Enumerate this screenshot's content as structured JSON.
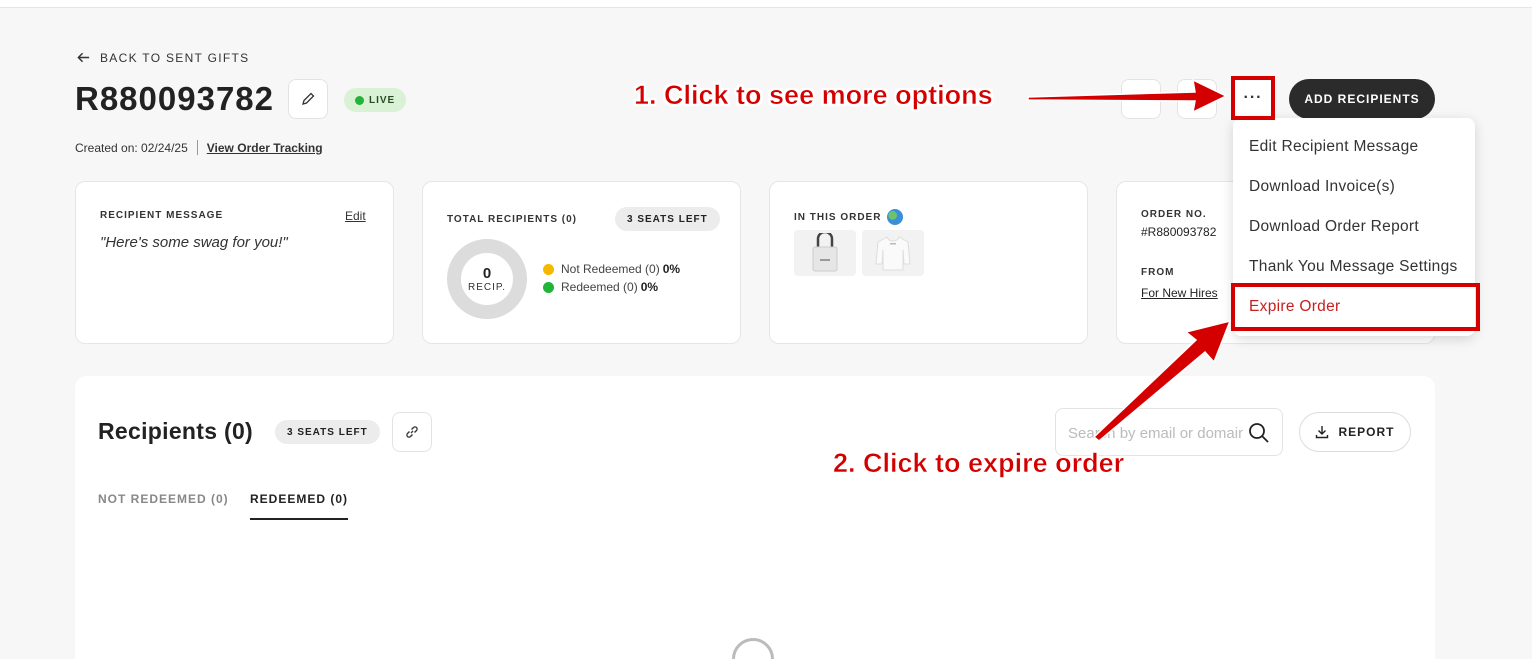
{
  "header": {
    "back_label": "BACK TO SENT GIFTS",
    "order_id": "R880093782",
    "status_badge": "LIVE",
    "created_label": "Created on: 02/24/25",
    "tracking_link": "View Order Tracking",
    "add_recipients_label": "ADD RECIPIENTS",
    "more_label": "···"
  },
  "cards": {
    "message": {
      "label": "RECIPIENT MESSAGE",
      "edit_label": "Edit",
      "text": "\"Here's some swag for you!\""
    },
    "totals": {
      "label": "TOTAL RECIPIENTS (0)",
      "seats_left": "3 SEATS LEFT",
      "donut_value": "0",
      "donut_caption": "RECIP.",
      "legend": [
        {
          "label": "Not Redeemed (0)",
          "pct": "0%",
          "color": "#f5b800"
        },
        {
          "label": "Redeemed (0)",
          "pct": "0%",
          "color": "#22b33a"
        }
      ]
    },
    "order": {
      "label": "IN THIS ORDER"
    },
    "details": {
      "order_no_label": "ORDER NO.",
      "order_no_value": "#R880093782",
      "from_label": "FROM",
      "from_value": "For New Hires"
    }
  },
  "dropdown": {
    "items": [
      "Edit Recipient Message",
      "Download Invoice(s)",
      "Download Order Report",
      "Thank You Message Settings",
      "Expire Order"
    ]
  },
  "recipients": {
    "title": "Recipients (0)",
    "seats_left": "3 SEATS LEFT",
    "search_placeholder": "Search by email or domain",
    "report_label": "REPORT",
    "tabs": [
      "NOT REDEEMED (0)",
      "REDEEMED (0)"
    ]
  },
  "annotations": {
    "step1": "1. Click to see more options",
    "step2": "2. Click to expire order",
    "color": "#d40000"
  }
}
